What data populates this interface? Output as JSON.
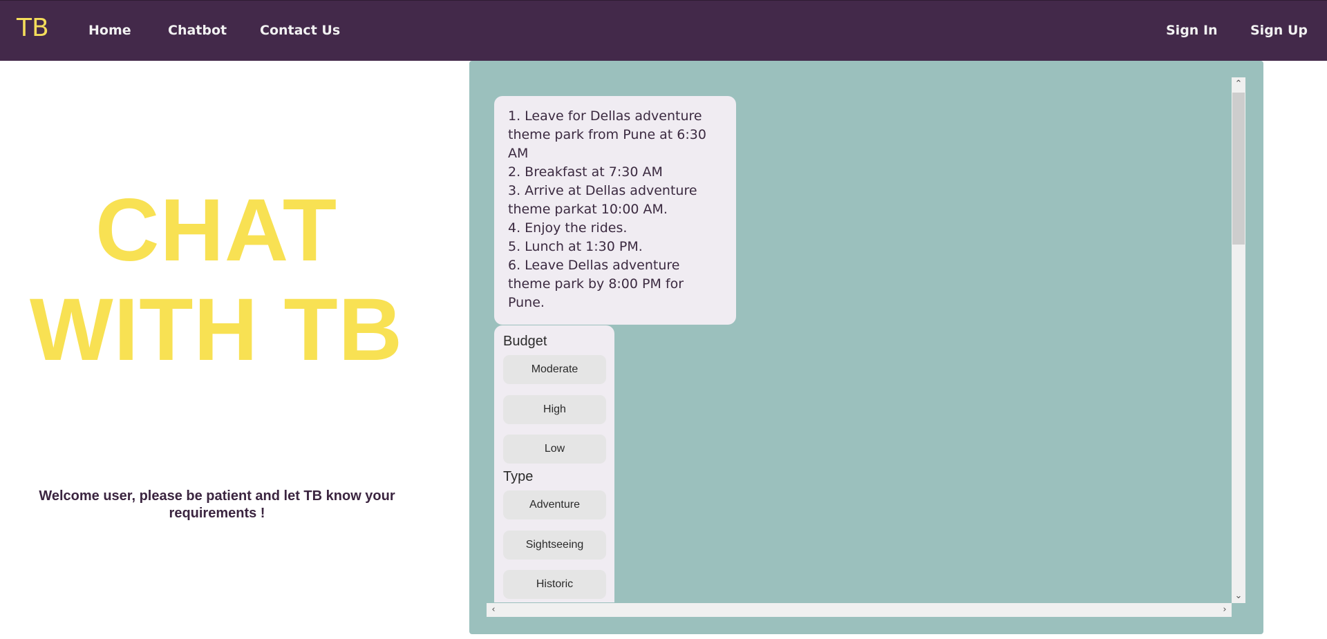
{
  "navbar": {
    "brand": "TB",
    "links": [
      "Home",
      "Chatbot",
      "Contact Us"
    ],
    "auth": {
      "sign_in": "Sign In",
      "sign_up": "Sign Up"
    }
  },
  "hero": {
    "title_line1": "CHAT",
    "title_line2": "WITH TB",
    "welcome": "Welcome user, please be patient and let TB know your requirements !"
  },
  "chat": {
    "message_lines": [
      "1. Leave for Dellas adventure theme park from Pune at 6:30 AM",
      "2. Breakfast at 7:30 AM",
      "3. Arrive at Dellas adventure theme parkat 10:00 AM.",
      "4. Enjoy the rides.",
      "5. Lunch at 1:30 PM.",
      "6. Leave Dellas adventure theme park by 8:00 PM for Pune."
    ],
    "options": {
      "budget_heading": "Budget",
      "budget": [
        "Moderate",
        "High",
        "Low"
      ],
      "type_heading": "Type",
      "type": [
        "Adventure",
        "Sightseeing",
        "Historic"
      ]
    }
  },
  "scrollbar_icons": {
    "up": "chevron-up-icon",
    "down": "chevron-down-icon",
    "left": "chevron-left-icon",
    "right": "chevron-right-icon"
  },
  "colors": {
    "navbar": "#43294a",
    "brand": "#f4dd5b",
    "hero_title": "#f8e153",
    "chat_panel": "#9bc0bd",
    "bubble": "#f0ecf2",
    "option_button": "#e5e5e5"
  }
}
